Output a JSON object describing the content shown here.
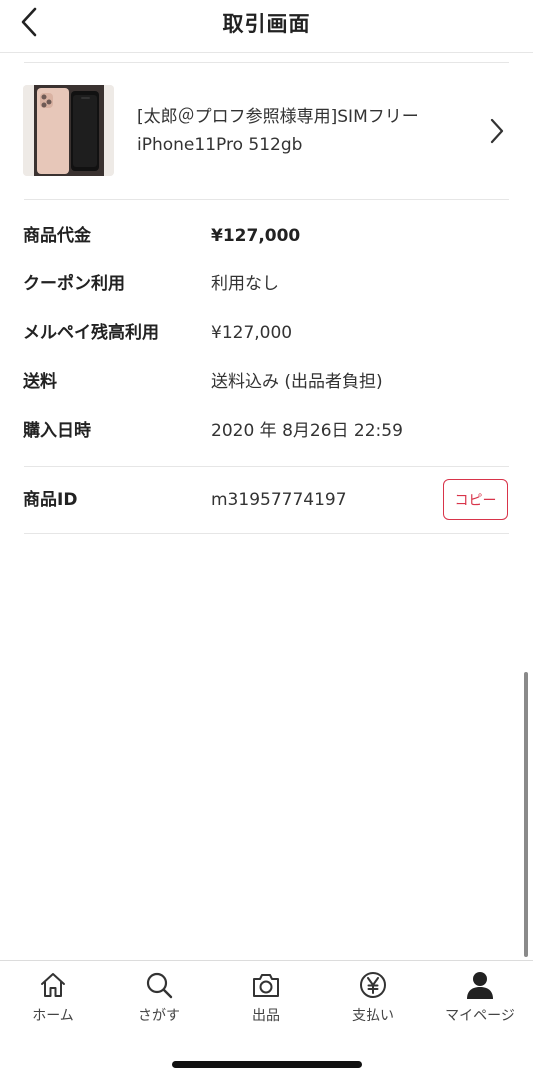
{
  "header": {
    "title": "取引画面"
  },
  "item": {
    "title_line1": "[太郎＠プロフ参照様専用]SIMフリー",
    "title_line2": "iPhone11Pro 512gb"
  },
  "details": {
    "price": {
      "label": "商品代金",
      "value": "¥127,000"
    },
    "coupon": {
      "label": "クーポン利用",
      "value": "利用なし"
    },
    "balance": {
      "label": "メルペイ残高利用",
      "value": "¥127,000"
    },
    "shipping": {
      "label": "送料",
      "value": "送料込み (出品者負担)"
    },
    "purchase_date": {
      "label": "購入日時",
      "value": "2020 年 8月26日 22:59"
    }
  },
  "product_id": {
    "label": "商品ID",
    "value": "m31957774197",
    "copy_label": "コピー"
  },
  "tabbar": {
    "tabs": [
      {
        "label": "ホーム",
        "icon": "home-icon"
      },
      {
        "label": "さがす",
        "icon": "search-icon"
      },
      {
        "label": "出品",
        "icon": "camera-icon"
      },
      {
        "label": "支払い",
        "icon": "yen-icon"
      },
      {
        "label": "マイページ",
        "icon": "person-icon"
      }
    ]
  },
  "colors": {
    "accent": "#d8344a",
    "divider": "#e6e6e6"
  }
}
